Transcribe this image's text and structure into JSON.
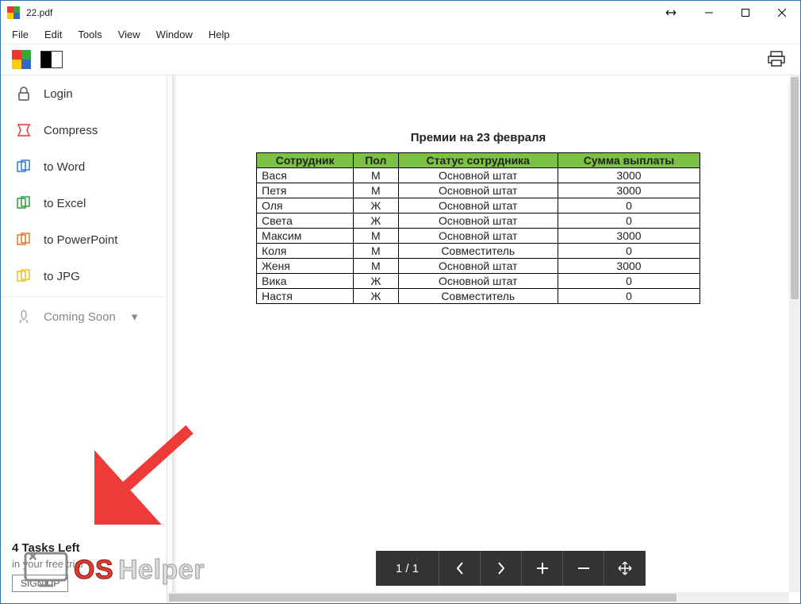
{
  "window": {
    "title": "22.pdf"
  },
  "menu": {
    "file": "File",
    "edit": "Edit",
    "tools": "Tools",
    "view": "View",
    "window": "Window",
    "help": "Help"
  },
  "sidebar": {
    "items": [
      {
        "label": "Login"
      },
      {
        "label": "Compress"
      },
      {
        "label": "to Word"
      },
      {
        "label": "to Excel"
      },
      {
        "label": "to PowerPoint"
      },
      {
        "label": "to JPG"
      },
      {
        "label": "Coming Soon"
      }
    ],
    "footer": {
      "tasks_left": "4 Tasks Left",
      "trial": "in your free trial",
      "signup": "SIGN UP"
    }
  },
  "pager": {
    "label": "1  /  1"
  },
  "document": {
    "title": "Премии на 23 февраля",
    "headers": [
      "Сотрудник",
      "Пол",
      "Статус сотрудника",
      "Сумма выплаты"
    ],
    "rows": [
      [
        "Вася",
        "М",
        "Основной штат",
        "3000"
      ],
      [
        "Петя",
        "М",
        "Основной штат",
        "3000"
      ],
      [
        "Оля",
        "Ж",
        "Основной штат",
        "0"
      ],
      [
        "Света",
        "Ж",
        "Основной штат",
        "0"
      ],
      [
        "Максим",
        "М",
        "Основной штат",
        "3000"
      ],
      [
        "Коля",
        "М",
        "Совместитель",
        "0"
      ],
      [
        "Женя",
        "М",
        "Основной штат",
        "3000"
      ],
      [
        "Вика",
        "Ж",
        "Основной штат",
        "0"
      ],
      [
        "Настя",
        "Ж",
        "Совместитель",
        "0"
      ]
    ]
  },
  "watermark": {
    "os": "OS",
    "helper": "Helper"
  },
  "chart_data": {
    "type": "table",
    "title": "Премии на 23 февраля",
    "columns": [
      "Сотрудник",
      "Пол",
      "Статус сотрудника",
      "Сумма выплаты"
    ],
    "rows": [
      {
        "Сотрудник": "Вася",
        "Пол": "М",
        "Статус сотрудника": "Основной штат",
        "Сумма выплаты": 3000
      },
      {
        "Сотрудник": "Петя",
        "Пол": "М",
        "Статус сотрудника": "Основной штат",
        "Сумма выплаты": 3000
      },
      {
        "Сотрудник": "Оля",
        "Пол": "Ж",
        "Статус сотрудника": "Основной штат",
        "Сумма выплаты": 0
      },
      {
        "Сотрудник": "Света",
        "Пол": "Ж",
        "Статус сотрудника": "Основной штат",
        "Сумма выплаты": 0
      },
      {
        "Сотрудник": "Максим",
        "Пол": "М",
        "Статус сотрудника": "Основной штат",
        "Сумма выплаты": 3000
      },
      {
        "Сотрудник": "Коля",
        "Пол": "М",
        "Статус сотрудника": "Совместитель",
        "Сумма выплаты": 0
      },
      {
        "Сотрудник": "Женя",
        "Пол": "М",
        "Статус сотрудника": "Основной штат",
        "Сумма выплаты": 3000
      },
      {
        "Сотрудник": "Вика",
        "Пол": "Ж",
        "Статус сотрудника": "Основной штат",
        "Сумма выплаты": 0
      },
      {
        "Сотрудник": "Настя",
        "Пол": "Ж",
        "Статус сотрудника": "Совместитель",
        "Сумма выплаты": 0
      }
    ]
  }
}
